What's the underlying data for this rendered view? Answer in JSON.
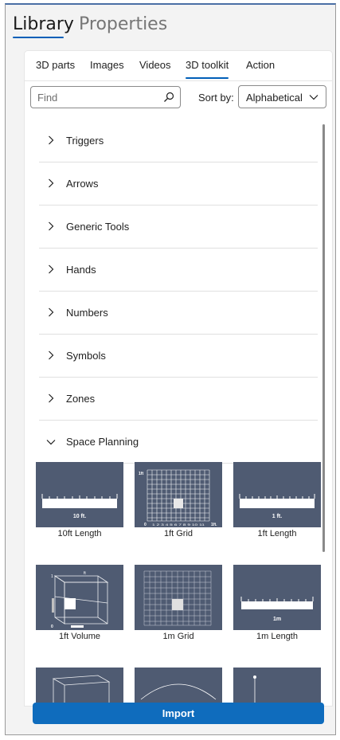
{
  "top_tabs": [
    {
      "label": "Library",
      "active": true
    },
    {
      "label": "Properties",
      "active": false
    }
  ],
  "sub_tabs": [
    {
      "label": "3D parts"
    },
    {
      "label": "Images"
    },
    {
      "label": "Videos"
    },
    {
      "label": "3D toolkit",
      "active": true
    },
    {
      "label": "Action"
    }
  ],
  "search": {
    "placeholder": "Find",
    "value": ""
  },
  "sort": {
    "label": "Sort by:",
    "value": "Alphabetical"
  },
  "categories": [
    {
      "label": "Triggers",
      "expanded": false
    },
    {
      "label": "Arrows",
      "expanded": false
    },
    {
      "label": "Generic Tools",
      "expanded": false
    },
    {
      "label": "Hands",
      "expanded": false
    },
    {
      "label": "Numbers",
      "expanded": false
    },
    {
      "label": "Symbols",
      "expanded": false
    },
    {
      "label": "Zones",
      "expanded": false
    },
    {
      "label": "Space Planning",
      "expanded": true
    }
  ],
  "tiles": [
    {
      "caption": "10ft Length",
      "ruler_label": "10 ft."
    },
    {
      "caption": "1ft Grid",
      "grid_label": "1ft",
      "corner_label": "1ft.",
      "origin_label": "0",
      "axis_numbers": "1 2 3 4 5 6 7 8 9 10 11"
    },
    {
      "caption": "1ft Length",
      "ruler_label": "1 ft."
    },
    {
      "caption": "1ft Volume",
      "axis_label": "ft",
      "origin_label": "0",
      "one_label": "1"
    },
    {
      "caption": "1m Grid"
    },
    {
      "caption": "1m Length",
      "ruler_label": "1m"
    },
    {
      "caption": ""
    },
    {
      "caption": ""
    },
    {
      "caption": ""
    }
  ],
  "import_label": "Import",
  "colors": {
    "accent": "#0f6cbd",
    "tile_bg": "#4f5b72"
  }
}
